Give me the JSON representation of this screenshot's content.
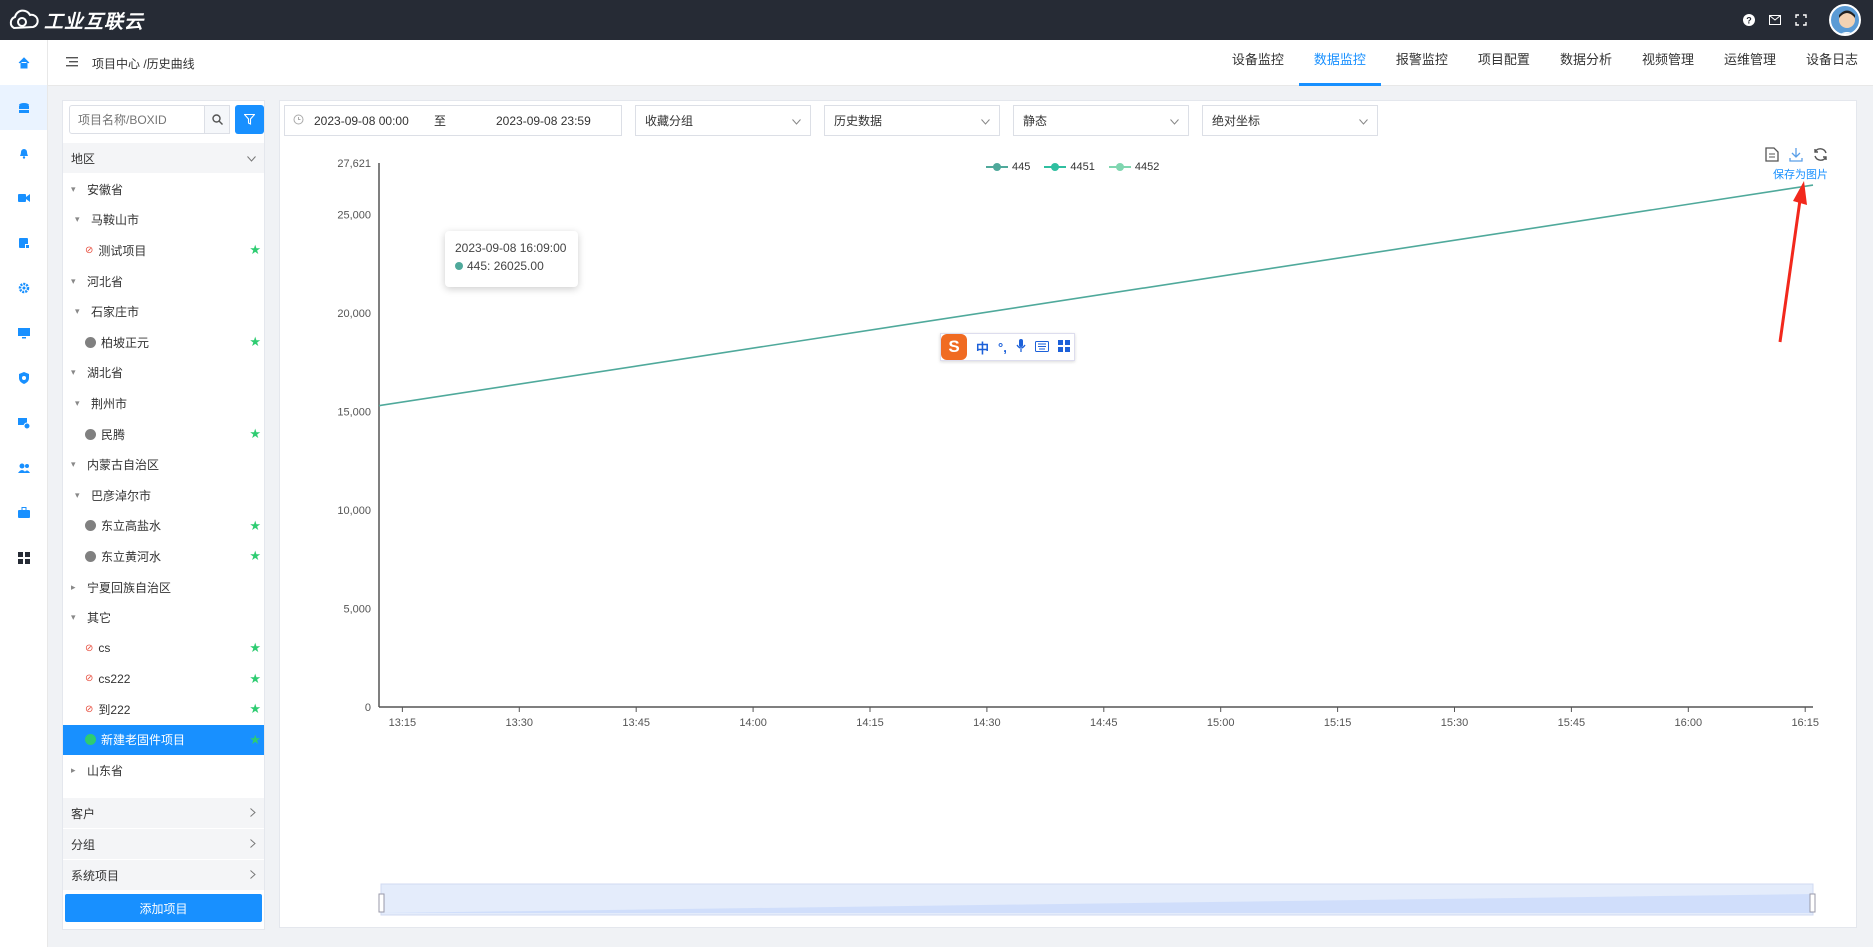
{
  "app": {
    "logo_text": "工业互联云"
  },
  "breadcrumb": {
    "text": "项目中心 /历史曲线"
  },
  "tabs": [
    "设备监控",
    "数据监控",
    "报警监控",
    "项目配置",
    "数据分析",
    "视频管理",
    "运维管理",
    "设备日志"
  ],
  "active_tab": "数据监控",
  "sidebar_icons": [
    "home-icon",
    "database-icon",
    "bell-icon",
    "video-icon",
    "storage-icon",
    "settings-icon",
    "monitor-icon",
    "shield-icon",
    "device-settings-icon",
    "users-icon",
    "briefcase-icon",
    "grid-icon"
  ],
  "left_panel": {
    "search_placeholder": "项目名称/BOXID",
    "section_region": "地区",
    "tree": [
      {
        "label": "安徽省",
        "level": 0,
        "caret": "down"
      },
      {
        "label": "马鞍山市",
        "level": 1,
        "caret": "down"
      },
      {
        "label": "测试项目",
        "level": 2,
        "icon": "link",
        "star": true
      },
      {
        "label": "河北省",
        "level": 0,
        "caret": "down"
      },
      {
        "label": "石家庄市",
        "level": 1,
        "caret": "down"
      },
      {
        "label": "柏坡正元",
        "level": 2,
        "icon": "gray-dot",
        "star": true
      },
      {
        "label": "湖北省",
        "level": 0,
        "caret": "down"
      },
      {
        "label": "荆州市",
        "level": 1,
        "caret": "down"
      },
      {
        "label": "民腾",
        "level": 2,
        "icon": "gray-dot",
        "star": true
      },
      {
        "label": "内蒙古自治区",
        "level": 0,
        "caret": "down"
      },
      {
        "label": "巴彦淖尔市",
        "level": 1,
        "caret": "down"
      },
      {
        "label": "东立高盐水",
        "level": 2,
        "icon": "gray-dot",
        "star": true
      },
      {
        "label": "东立黄河水",
        "level": 2,
        "icon": "gray-dot",
        "star": true
      },
      {
        "label": "宁夏回族自治区",
        "level": 0,
        "caret": "right"
      },
      {
        "label": "其它",
        "level": 0,
        "caret": "down"
      },
      {
        "label": "cs",
        "level": 2,
        "icon": "link",
        "star": true
      },
      {
        "label": "cs222",
        "level": 2,
        "icon": "link",
        "star": true
      },
      {
        "label": "到222",
        "level": 2,
        "icon": "link",
        "star": true
      },
      {
        "label": "新建老固件项目",
        "level": 2,
        "icon": "green-dot",
        "star": true,
        "selected": true
      },
      {
        "label": "山东省",
        "level": 0,
        "caret": "right"
      }
    ],
    "sections": [
      "客户",
      "分组",
      "系统项目"
    ],
    "add_button": "添加项目"
  },
  "filters": {
    "start_date": "2023-09-08 00:00",
    "range_sep": "至",
    "end_date": "2023-09-08 23:59",
    "favorite_group": "收藏分组",
    "data_type": "历史数据",
    "mode": "静态",
    "coordinate": "绝对坐标"
  },
  "toolbox": {
    "save_image_label": "保存为图片"
  },
  "tooltip": {
    "time": "2023-09-08 16:09:00",
    "series": "445",
    "value_text": "445: 26025.00"
  },
  "ime_toolbar": {
    "mode": "中",
    "punct": "°,"
  },
  "chart_data": {
    "type": "line",
    "legend": [
      "445",
      "4451",
      "4452"
    ],
    "series_colors": [
      "#4fa99b",
      "#2fbfa0",
      "#7fd6b0"
    ],
    "y_ticks": [
      "0",
      "5,000",
      "10,000",
      "15,000",
      "20,000",
      "25,000",
      "27,621"
    ],
    "ylim": [
      0,
      27621
    ],
    "x_ticks": [
      "13:15",
      "13:30",
      "13:45",
      "14:00",
      "14:15",
      "14:30",
      "14:45",
      "15:00",
      "15:15",
      "15:30",
      "15:45",
      "16:00",
      "16:15"
    ],
    "xlim": [
      "13:12",
      "16:16"
    ],
    "series": [
      {
        "name": "445",
        "x": [
          "13:12",
          "16:16"
        ],
        "values": [
          15300,
          26500
        ]
      }
    ]
  }
}
